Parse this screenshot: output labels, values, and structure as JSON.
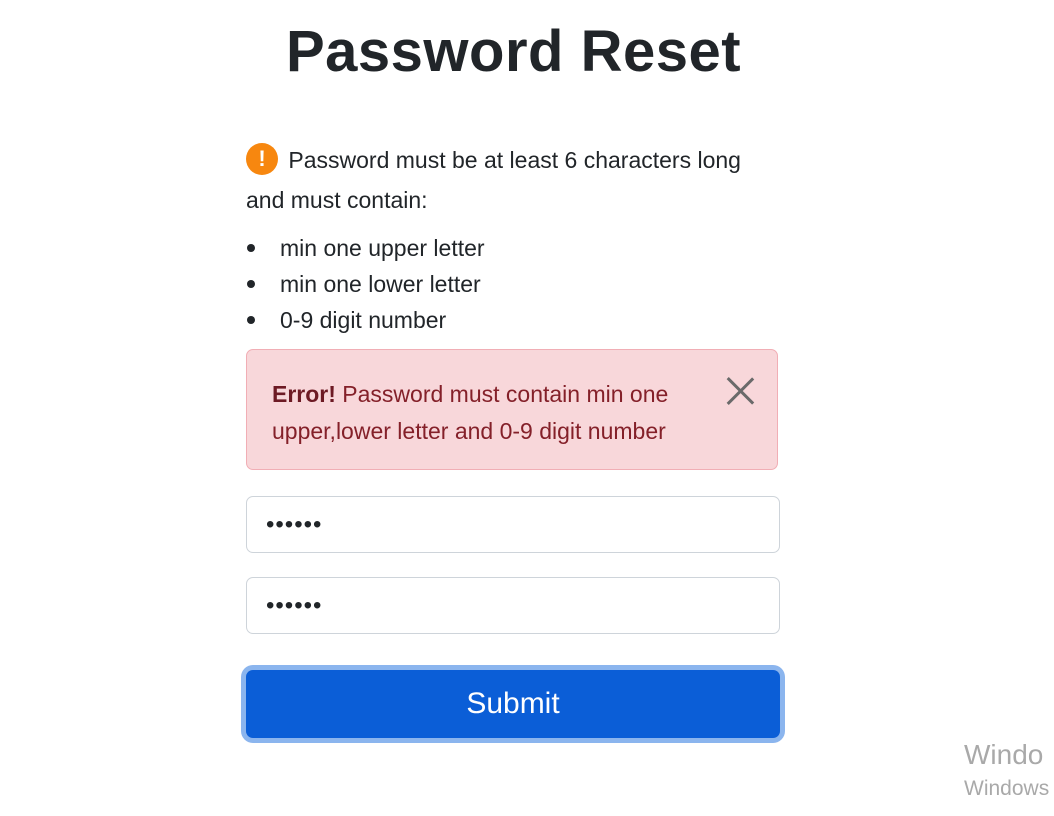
{
  "page": {
    "title": "Password Reset"
  },
  "requirements": {
    "icon": "exclamation-icon",
    "text": "Password must be at least 6 characters long and must contain:",
    "items": [
      "min one upper letter",
      "min one lower letter",
      "0-9 digit number"
    ]
  },
  "alert": {
    "strong": "Error!",
    "message": "Password must contain min one upper,lower letter and 0-9 digit number",
    "close_icon": "close-icon"
  },
  "form": {
    "password_value": "••••••",
    "confirm_value": "••••••",
    "submit_label": "Submit"
  },
  "watermark": {
    "line1": "Windo",
    "line2": "Windows"
  },
  "colors": {
    "primary": "#0b5ed7",
    "alert_bg": "#f8d7da",
    "alert_text": "#842029",
    "warning_icon": "#f7870f"
  }
}
